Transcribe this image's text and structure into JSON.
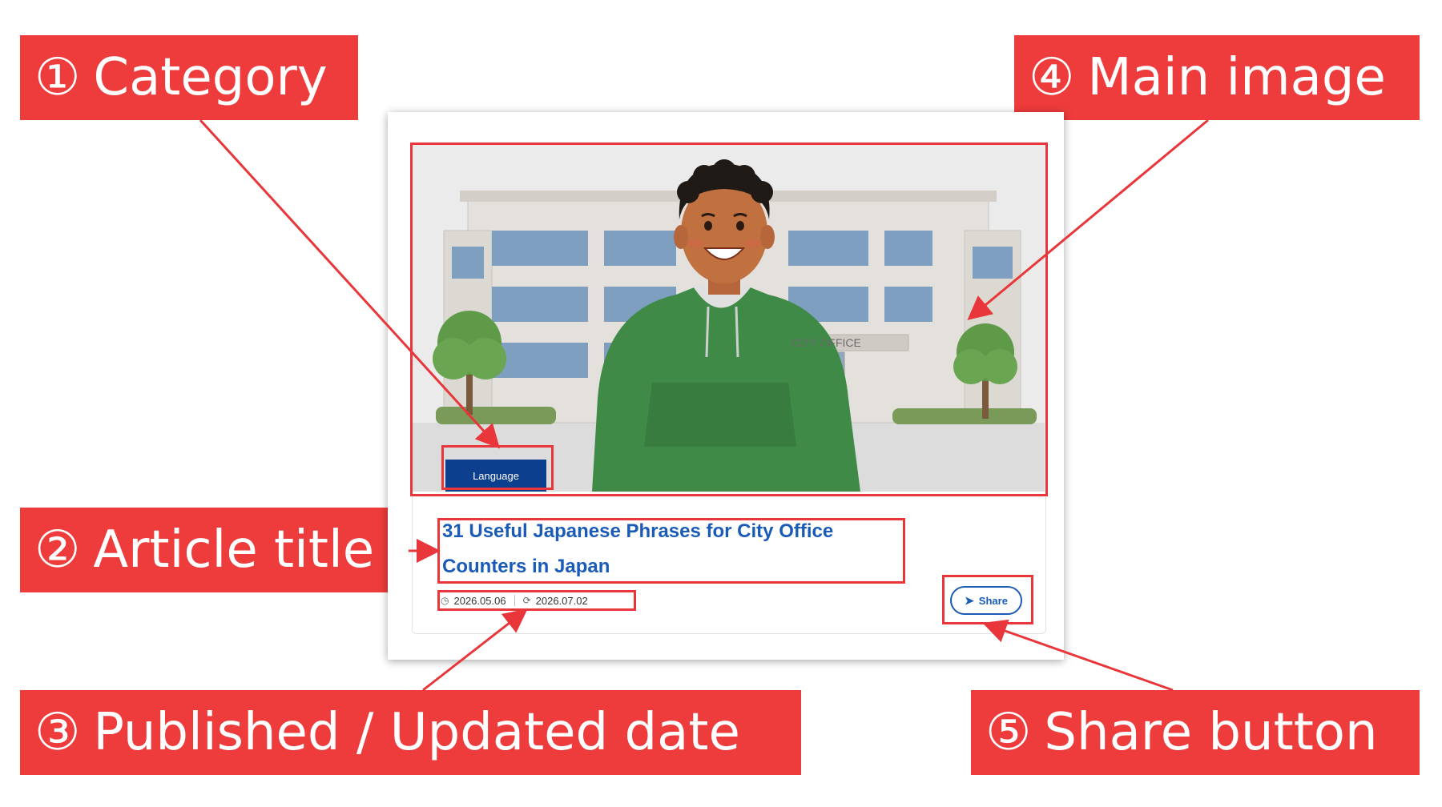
{
  "callouts": {
    "category": {
      "num": "①",
      "label": "Category"
    },
    "title": {
      "num": "②",
      "label": "Article title"
    },
    "dates": {
      "num": "③",
      "label": "Published / Updated date"
    },
    "image": {
      "num": "④",
      "label": "Main image"
    },
    "share": {
      "num": "⑤",
      "label": "Share button"
    }
  },
  "card": {
    "category": "Language",
    "title": "31 Useful Japanese Phrases for City Office Counters in Japan",
    "published": "2026.05.06",
    "updated": "2026.07.02",
    "share_label": "Share",
    "image_sign": "CITY OFFICE",
    "icons": {
      "published": "clock-icon",
      "updated": "refresh-icon",
      "share": "share-icon"
    }
  },
  "colors": {
    "callout_bg": "#ee3b3b",
    "highlight": "#e8363a",
    "title": "#1a5bb8",
    "badge": "#0d3f8f"
  }
}
